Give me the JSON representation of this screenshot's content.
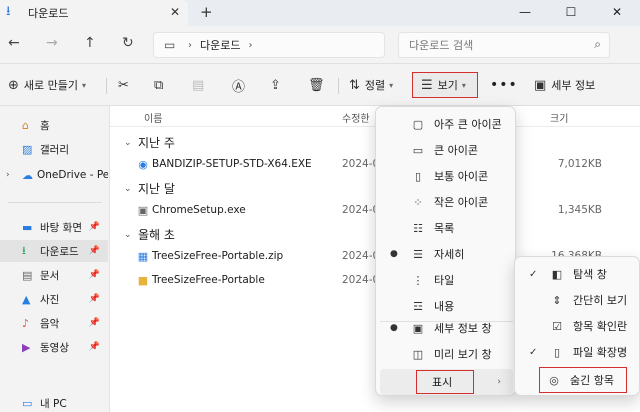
{
  "window": {
    "tab_title": "다운로드",
    "tab_close": "✕",
    "new_tab": "+",
    "minimize": "—",
    "maximize": "☐",
    "close": "✕"
  },
  "address": {
    "crumb": "다운로드",
    "search_placeholder": "다운로드 검색"
  },
  "toolbar": {
    "new_label": "새로 만들기",
    "sort_label": "정렬",
    "view_label": "보기",
    "more_label": "•••",
    "details_label": "세부 정보"
  },
  "sidebar": {
    "items": [
      {
        "label": "홈",
        "icon": "home-icon"
      },
      {
        "label": "갤러리",
        "icon": "gallery-icon"
      },
      {
        "label": "OneDrive - Pers",
        "icon": "cloud-icon"
      },
      {
        "label": "바탕 화면",
        "icon": "desktop-icon"
      },
      {
        "label": "다운로드",
        "icon": "download-icon"
      },
      {
        "label": "문서",
        "icon": "document-icon"
      },
      {
        "label": "사진",
        "icon": "pictures-icon"
      },
      {
        "label": "음악",
        "icon": "music-icon"
      },
      {
        "label": "동영상",
        "icon": "video-icon"
      },
      {
        "label": "내 PC",
        "icon": "pc-icon"
      }
    ]
  },
  "main": {
    "columns": {
      "name": "이름",
      "date": "수정한",
      "size": "크기"
    },
    "groups": [
      {
        "label": "지난 주"
      },
      {
        "label": "지난 달"
      },
      {
        "label": "올해 초"
      }
    ],
    "files": [
      {
        "name": "BANDIZIP-SETUP-STD-X64.EXE",
        "date": "2024-0",
        "size": "7,012KB"
      },
      {
        "name": "ChromeSetup.exe",
        "date": "2024-0",
        "size": "1,345KB"
      },
      {
        "name": "TreeSizeFree-Portable.zip",
        "date": "2024-0",
        "size": "16,368KB"
      },
      {
        "name": "TreeSizeFree-Portable",
        "date": "2024-0",
        "size": ""
      }
    ]
  },
  "view_menu": {
    "items": [
      {
        "label": "아주 큰 아이콘",
        "icon": "extra-large-icons-icon"
      },
      {
        "label": "큰 아이콘",
        "icon": "large-icons-icon"
      },
      {
        "label": "보통 아이콘",
        "icon": "medium-icons-icon"
      },
      {
        "label": "작은 아이콘",
        "icon": "small-icons-icon"
      },
      {
        "label": "목록",
        "icon": "list-icon"
      },
      {
        "label": "자세히",
        "icon": "details-icon",
        "selected": true
      },
      {
        "label": "타일",
        "icon": "tiles-icon"
      },
      {
        "label": "내용",
        "icon": "content-icon"
      },
      {
        "label": "세부 정보 창",
        "icon": "details-pane-icon",
        "selected": true
      },
      {
        "label": "미리 보기 창",
        "icon": "preview-pane-icon"
      }
    ],
    "show_label": "표시"
  },
  "show_submenu": {
    "items": [
      {
        "label": "탐색 창",
        "checked": true
      },
      {
        "label": "간단히 보기",
        "checked": false
      },
      {
        "label": "항목 확인란",
        "checked": false
      },
      {
        "label": "파일 확장명",
        "checked": true
      },
      {
        "label": "숨긴 항목",
        "checked": false
      }
    ]
  },
  "colors": {
    "accent": "#2b7de1",
    "highlight_border": "#d32f2f"
  }
}
